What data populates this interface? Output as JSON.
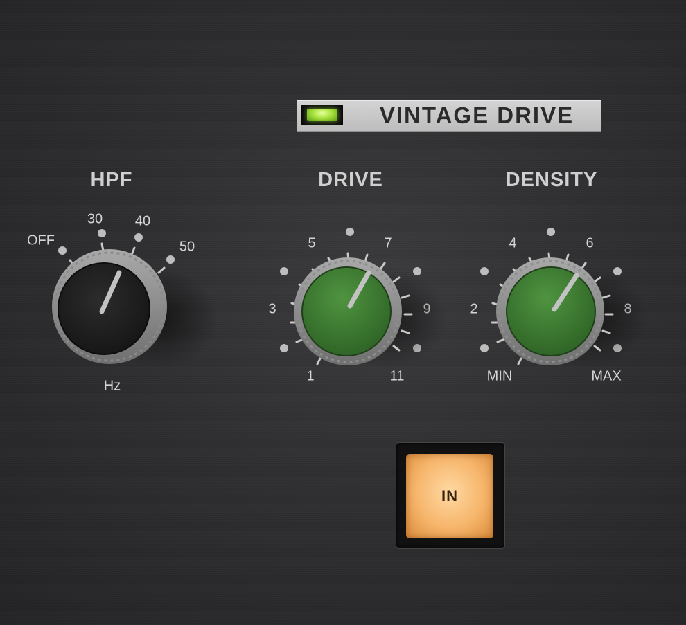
{
  "plugin": {
    "name": "VINTAGE DRIVE",
    "power_led": "on",
    "led_color": "#a6e23c"
  },
  "controls": {
    "hpf": {
      "title": "HPF",
      "unit_label": "Hz",
      "scale_labels": [
        "OFF",
        "30",
        "40",
        "50"
      ],
      "knob_color": "#1e1e1e"
    },
    "drive": {
      "title": "DRIVE",
      "scale_labels": [
        "1",
        "3",
        "5",
        "7",
        "9",
        "11"
      ],
      "knob_color": "#3f7d32"
    },
    "density": {
      "title": "DENSITY",
      "scale_labels": [
        "MIN",
        "2",
        "4",
        "6",
        "8",
        "MAX"
      ],
      "knob_color": "#3f7d32"
    }
  },
  "in_button": {
    "label": "IN",
    "state": "engaged",
    "color": "#f6b56b"
  }
}
